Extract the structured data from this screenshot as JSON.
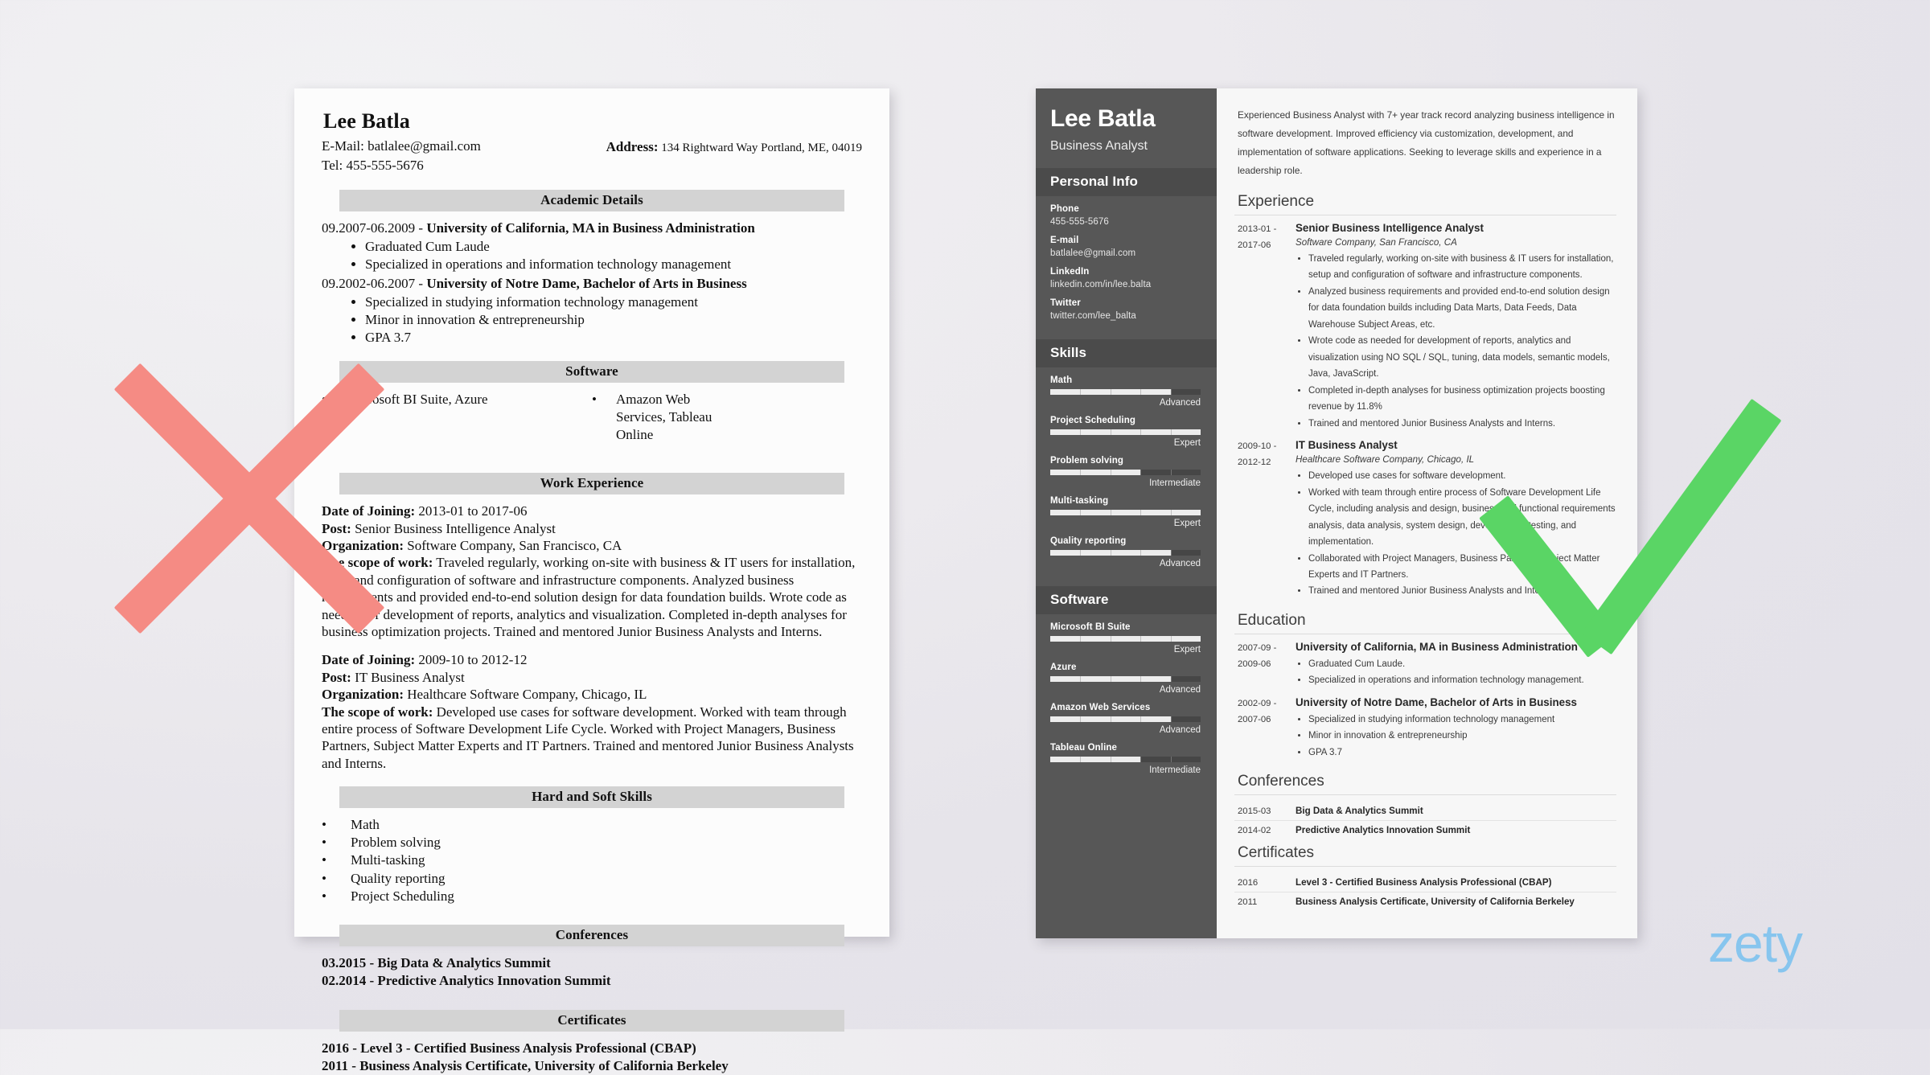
{
  "watermark": {
    "brand": "zety"
  },
  "bad_resume": {
    "name": "Lee Batla",
    "email_line": "E-Mail: batlalee@gmail.com",
    "tel_line": "Tel: 455-555-5676",
    "address_label": "Address:",
    "address_value": "134 Rightward Way Portland, ME, 04019",
    "sections": {
      "academic": "Academic Details",
      "software": "Software",
      "work": "Work Experience",
      "skills": "Hard and Soft Skills",
      "conferences": "Conferences",
      "certificates": "Certificates"
    },
    "education": [
      {
        "dates": "09.2007-06.2009 - ",
        "title": "University of California, MA in Business Administration",
        "bullets": [
          "Graduated Cum Laude",
          "Specialized in operations and information technology management"
        ]
      },
      {
        "dates": "09.2002-06.2007 - ",
        "title": "University of Notre Dame, Bachelor of Arts in Business",
        "bullets": [
          "Specialized in studying information technology management",
          "Minor in innovation & entrepreneurship",
          "GPA 3.7"
        ]
      }
    ],
    "software": [
      "Microsoft BI Suite, Azure",
      "Amazon Web Services, Tableau Online"
    ],
    "work": [
      {
        "date_label": "Date of Joining:",
        "date_value": " 2013-01 to 2017-06",
        "post_label": "Post:",
        "post_value": " Senior Business Intelligence Analyst",
        "org_label": "Organization:",
        "org_value": " Software Company, San Francisco, CA",
        "scope_label": "The scope of work:",
        "scope_value": " Traveled regularly, working on-site with business & IT users for installation, setup and configuration of software and infrastructure components. Analyzed business requirements and provided end-to-end solution design for data foundation builds. Wrote code as needed for development of reports, analytics and visualization. Completed in-depth analyses for business optimization projects. Trained and mentored Junior Business Analysts and Interns."
      },
      {
        "date_label": "Date of Joining:",
        "date_value": " 2009-10 to 2012-12",
        "post_label": "Post:",
        "post_value": " IT Business Analyst",
        "org_label": "Organization:",
        "org_value": " Healthcare Software Company, Chicago, IL",
        "scope_label": "The scope of work:",
        "scope_value": " Developed use cases for software development. Worked with team through entire process of Software Development Life Cycle. Worked with Project Managers, Business Partners, Subject Matter Experts and IT Partners. Trained and mentored Junior Business Analysts and Interns."
      }
    ],
    "skills": [
      "Math",
      "Problem solving",
      "Multi-tasking",
      "Quality reporting",
      "Project Scheduling"
    ],
    "conferences": [
      "03.2015 - Big Data & Analytics Summit",
      "02.2014 - Predictive Analytics Innovation Summit"
    ],
    "certificates": [
      "2016 - Level 3 - Certified Business Analysis Professional (CBAP)",
      "2011 - Business Analysis Certificate, University of California Berkeley"
    ]
  },
  "good_resume": {
    "name": "Lee Batla",
    "role": "Business Analyst",
    "sidebar": {
      "personal_info_heading": "Personal Info",
      "fields": [
        {
          "label": "Phone",
          "value": "455-555-5676"
        },
        {
          "label": "E-mail",
          "value": "batlalee@gmail.com"
        },
        {
          "label": "LinkedIn",
          "value": "linkedin.com/in/lee.balta"
        },
        {
          "label": "Twitter",
          "value": "twitter.com/lee_balta"
        }
      ],
      "skills_heading": "Skills",
      "skills": [
        {
          "label": "Math",
          "level": "Advanced",
          "percent": 80
        },
        {
          "label": "Project Scheduling",
          "level": "Expert",
          "percent": 100
        },
        {
          "label": "Problem solving",
          "level": "Intermediate",
          "percent": 60
        },
        {
          "label": "Multi-tasking",
          "level": "Expert",
          "percent": 100
        },
        {
          "label": "Quality reporting",
          "level": "Advanced",
          "percent": 80
        }
      ],
      "software_heading": "Software",
      "software": [
        {
          "label": "Microsoft BI Suite",
          "level": "Expert",
          "percent": 100
        },
        {
          "label": "Azure",
          "level": "Advanced",
          "percent": 80
        },
        {
          "label": "Amazon Web Services",
          "level": "Advanced",
          "percent": 80
        },
        {
          "label": "Tableau Online",
          "level": "Intermediate",
          "percent": 60
        }
      ]
    },
    "summary": "Experienced Business Analyst with 7+ year track record analyzing business intelligence in software development. Improved efficiency via customization, development, and implementation of software applications. Seeking to leverage skills and experience in a leadership role.",
    "headings": {
      "experience": "Experience",
      "education": "Education",
      "conferences": "Conferences",
      "certificates": "Certificates"
    },
    "experience": [
      {
        "date": "2013-01 -\n2017-06",
        "title": "Senior Business Intelligence Analyst",
        "org": "Software Company, San Francisco, CA",
        "bullets": [
          "Traveled regularly, working on-site with business & IT users for installation, setup and configuration of software and infrastructure components.",
          "Analyzed business requirements and provided end-to-end solution design for data foundation builds including Data Marts, Data Feeds, Data Warehouse Subject Areas, etc.",
          "Wrote code as needed for development of reports, analytics and visualization using NO SQL / SQL, tuning, data models, semantic models, Java, JavaScript.",
          "Completed in-depth analyses for business optimization projects boosting revenue by 11.8%",
          "Trained and mentored Junior Business Analysts and Interns."
        ]
      },
      {
        "date": "2009-10 -\n2012-12",
        "title": "IT Business Analyst",
        "org": "Healthcare Software Company, Chicago, IL",
        "bullets": [
          "Developed use cases for software development.",
          "Worked with team through entire process of Software Development Life Cycle, including analysis and design, business and functional requirements analysis, data analysis, system design, development, testing, and implementation.",
          "Collaborated with Project Managers, Business Partners, Subject Matter Experts and IT Partners.",
          "Trained and mentored Junior Business Analysts and Interns."
        ]
      }
    ],
    "education": [
      {
        "date": "2007-09 -\n2009-06",
        "title": "University of California, MA in Business Administration",
        "bullets": [
          "Graduated Cum Laude.",
          "Specialized in operations and information technology management."
        ]
      },
      {
        "date": "2002-09 -\n2007-06",
        "title": "University of Notre Dame, Bachelor of Arts in Business",
        "bullets": [
          "Specialized in studying information technology management",
          "Minor in innovation & entrepreneurship",
          "GPA 3.7"
        ]
      }
    ],
    "conferences": [
      {
        "date": "2015-03",
        "title": "Big Data & Analytics Summit"
      },
      {
        "date": "2014-02",
        "title": "Predictive Analytics Innovation Summit"
      }
    ],
    "certificates": [
      {
        "date": "2016",
        "title": "Level 3 - Certified Business Analysis Professional (CBAP)"
      },
      {
        "date": "2011",
        "title": "Business Analysis Certificate, University of California Berkeley"
      }
    ]
  },
  "colors": {
    "reject_mark": "#f58b84",
    "approve_mark": "#5ad565",
    "sidebar_bg": "#575757",
    "brand": "#87c5ee"
  }
}
